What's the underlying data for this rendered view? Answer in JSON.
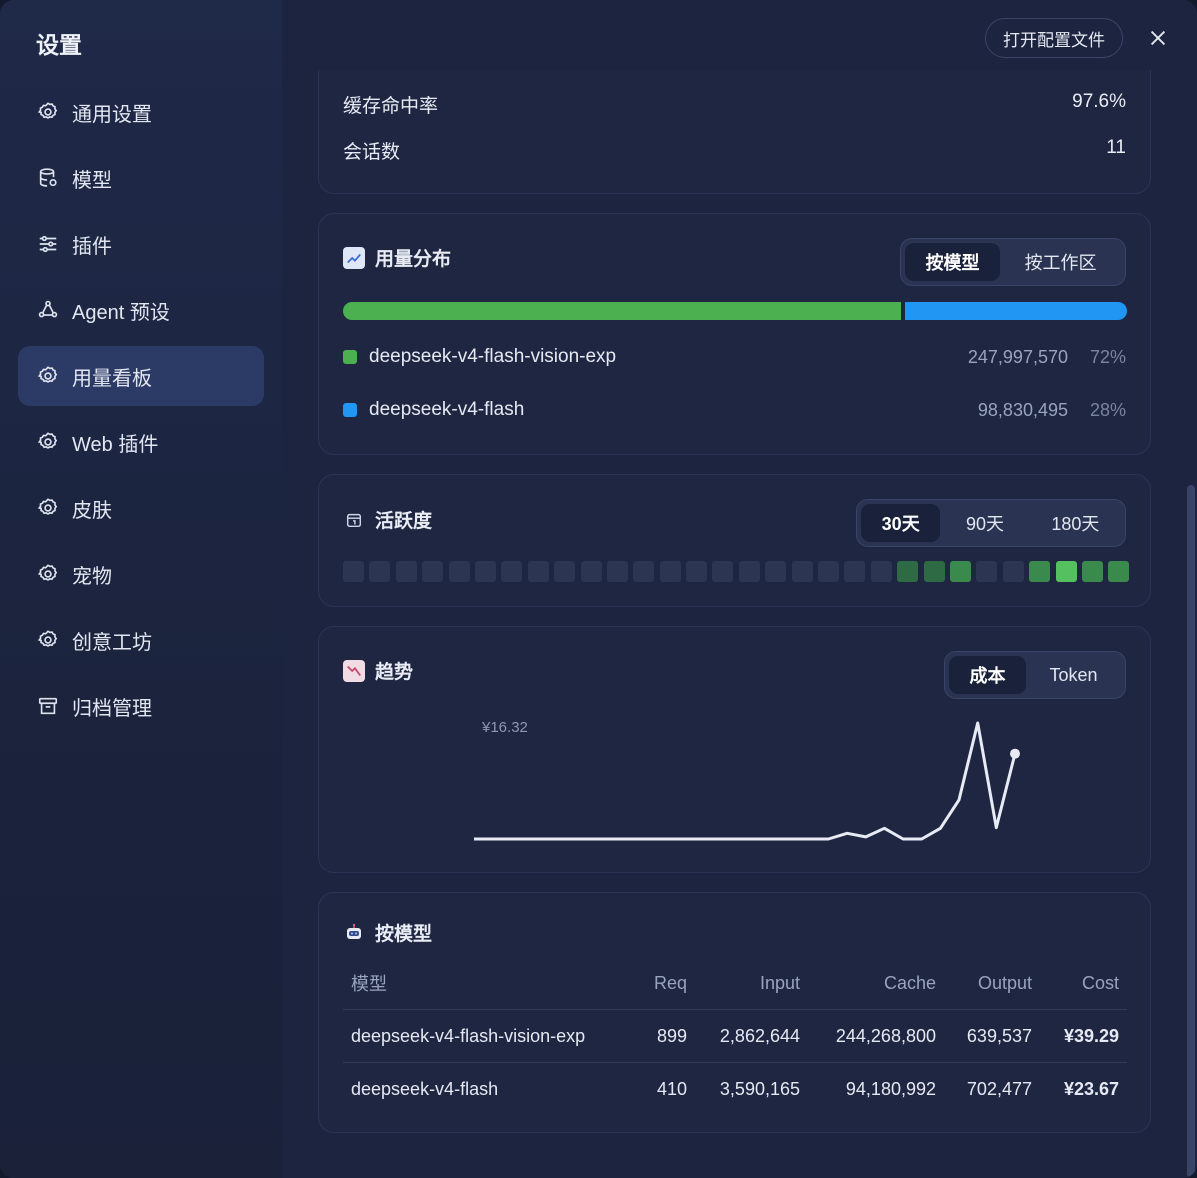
{
  "window": {
    "title": "设置",
    "open_config_label": "打开配置文件"
  },
  "sidebar": {
    "items": [
      {
        "label": "通用设置",
        "icon": "gear-icon"
      },
      {
        "label": "模型",
        "icon": "database-icon"
      },
      {
        "label": "插件",
        "icon": "sliders-icon"
      },
      {
        "label": "Agent 预设",
        "icon": "agent-icon"
      },
      {
        "label": "用量看板",
        "icon": "gear-icon",
        "active": true
      },
      {
        "label": "Web 插件",
        "icon": "gear-icon"
      },
      {
        "label": "皮肤",
        "icon": "gear-icon"
      },
      {
        "label": "宠物",
        "icon": "gear-icon"
      },
      {
        "label": "创意工坊",
        "icon": "gear-icon"
      },
      {
        "label": "归档管理",
        "icon": "archive-icon"
      }
    ]
  },
  "stats": {
    "cache_hit_label": "缓存命中率",
    "cache_hit_value": "97.6%",
    "sessions_label": "会话数",
    "sessions_value": "11"
  },
  "usage": {
    "title": "用量分布",
    "tabs": [
      "按模型",
      "按工作区"
    ],
    "active_tab": 0,
    "models": [
      {
        "name": "deepseek-v4-flash-vision-exp",
        "tokens": "247,997,570",
        "pct": "72%",
        "share": 0.716,
        "color": "#4caf50"
      },
      {
        "name": "deepseek-v4-flash",
        "tokens": "98,830,495",
        "pct": "28%",
        "share": 0.284,
        "color": "#2196f3"
      }
    ]
  },
  "activity": {
    "title": "活跃度",
    "tabs": [
      "30天",
      "90天",
      "180天"
    ],
    "active_tab": 0,
    "levels": [
      0,
      0,
      0,
      0,
      0,
      0,
      0,
      0,
      0,
      0,
      0,
      0,
      0,
      0,
      0,
      0,
      0,
      0,
      0,
      0,
      0,
      1,
      1,
      2,
      0,
      0,
      2,
      3,
      2,
      2
    ]
  },
  "trend": {
    "title": "趋势",
    "tabs": [
      "成本",
      "Token"
    ],
    "active_tab": 0,
    "max_label": "¥16.32"
  },
  "chart_data": {
    "type": "line",
    "title": "趋势",
    "annotations": [
      "¥16.32"
    ],
    "series": [
      {
        "values": [
          0,
          0,
          0,
          0,
          0,
          0,
          0,
          0,
          0,
          0,
          0,
          0,
          0,
          0,
          0,
          0,
          0,
          0,
          0,
          0,
          0.8,
          0.3,
          1.5,
          0,
          0,
          1.5,
          5.5,
          16.32,
          1.6,
          12
        ]
      }
    ],
    "ylim": [
      0,
      16.32
    ],
    "grid": false
  },
  "by_model": {
    "title": "按模型",
    "columns": [
      "模型",
      "Req",
      "Input",
      "Cache",
      "Output",
      "Cost"
    ],
    "rows": [
      [
        "deepseek-v4-flash-vision-exp",
        "899",
        "2,862,644",
        "244,268,800",
        "639,537",
        "¥39.29"
      ],
      [
        "deepseek-v4-flash",
        "410",
        "3,590,165",
        "94,180,992",
        "702,477",
        "¥23.67"
      ]
    ]
  }
}
